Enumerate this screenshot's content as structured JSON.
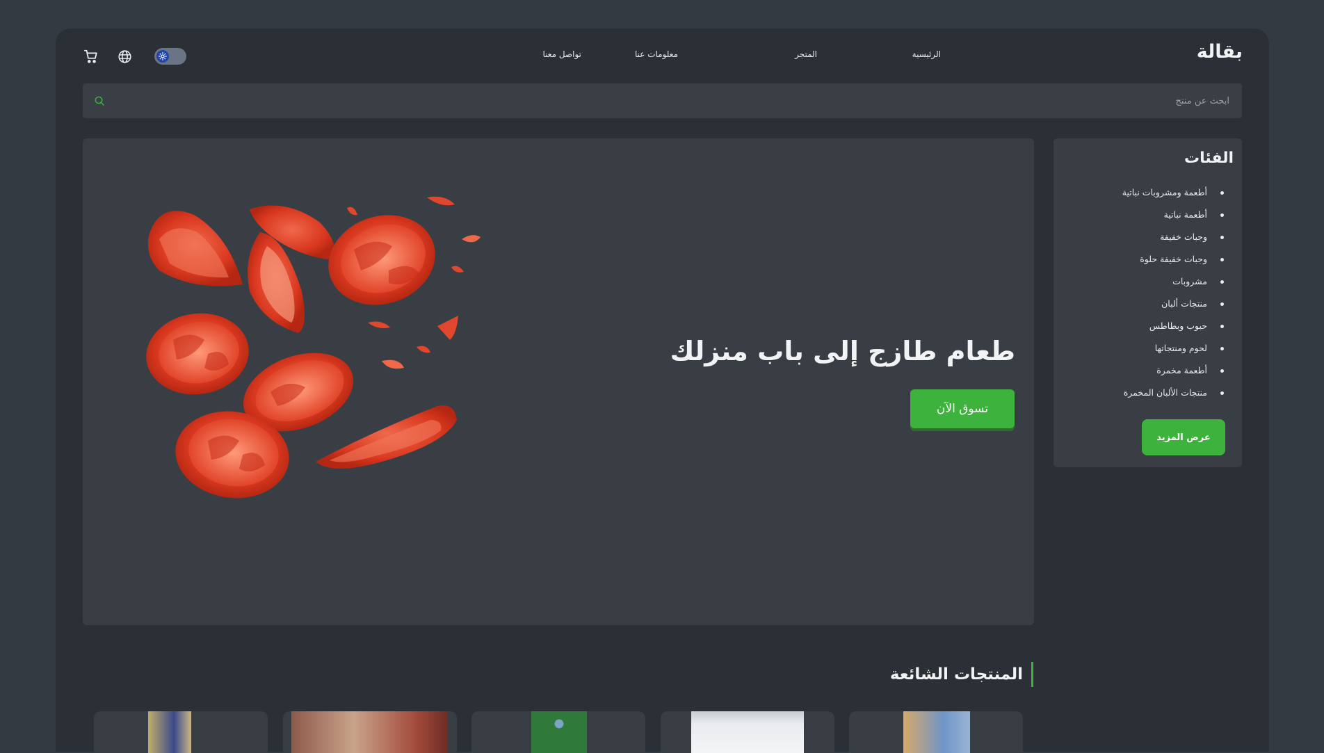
{
  "header": {
    "logo": "بقالة",
    "nav": [
      "الرئيسية",
      "المتجر",
      "معلومات عنا",
      "تواصل معنا"
    ]
  },
  "search": {
    "placeholder": "ابحث عن منتج"
  },
  "hero": {
    "title": "طعام طازج إلى باب منزلك",
    "cta": "تسوق الآن"
  },
  "categories": {
    "title": "الفئات",
    "items": [
      "أطعمة ومشروبات نباتية",
      "أطعمة نباتية",
      "وجبات خفيفة",
      "وجبات خفيفة حلوة",
      "مشروبات",
      "منتجات ألبان",
      "حبوب وبطاطس",
      "لحوم ومنتجاتها",
      "أطعمة مخمرة",
      "منتجات الألبان المخمرة"
    ],
    "more": "عرض المزيد"
  },
  "popular": {
    "title": "المنتجات الشائعة"
  },
  "colors": {
    "accent": "#3db33d",
    "page_bg": "#343a42",
    "panel": "#393e45"
  },
  "icons": [
    "cart-icon",
    "globe-icon",
    "sun-icon",
    "search-icon"
  ]
}
